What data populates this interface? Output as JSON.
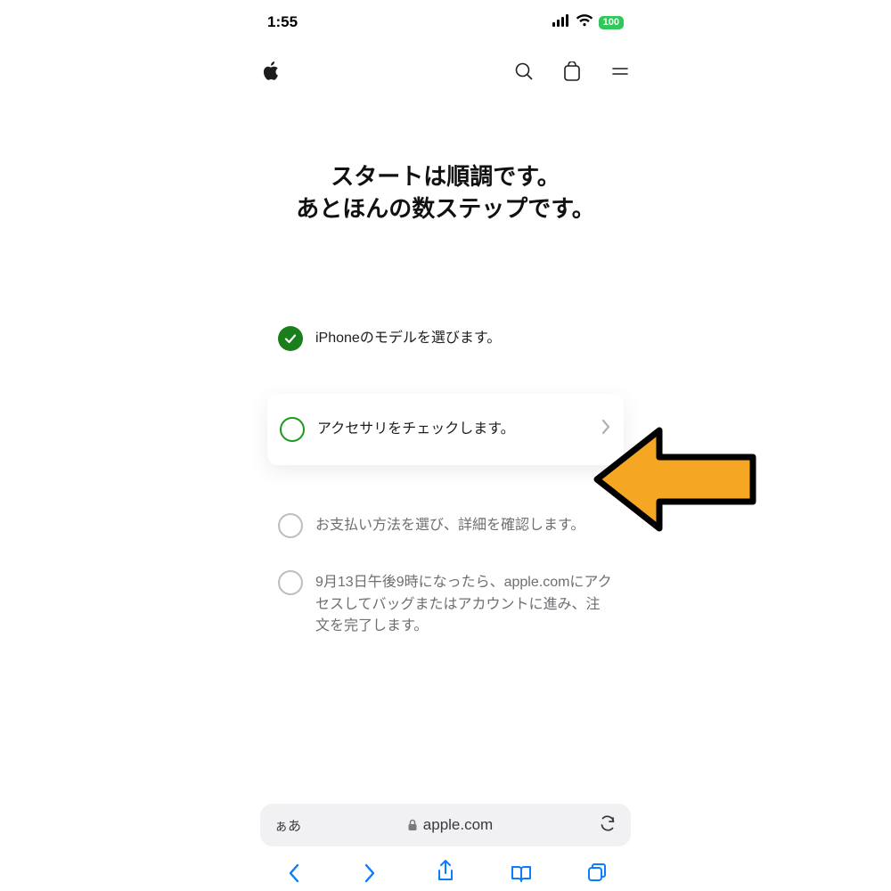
{
  "statusbar": {
    "time": "1:55",
    "battery": "100"
  },
  "page": {
    "title_line1": "スタートは順調です。",
    "title_line2": "あとほんの数ステップです。"
  },
  "steps": [
    {
      "state": "done",
      "text": "iPhoneのモデルを選びます。"
    },
    {
      "state": "active",
      "text": "アクセサリをチェックします。"
    },
    {
      "state": "todo",
      "text": "お支払い方法を選び、詳細を確認します。"
    },
    {
      "state": "todo",
      "text": "9月13日午後9時になったら、apple.comにアクセスしてバッグまたはアカウントに進み、注文を完了します。"
    }
  ],
  "browser": {
    "aa": "ぁあ",
    "domain": "apple.com"
  }
}
